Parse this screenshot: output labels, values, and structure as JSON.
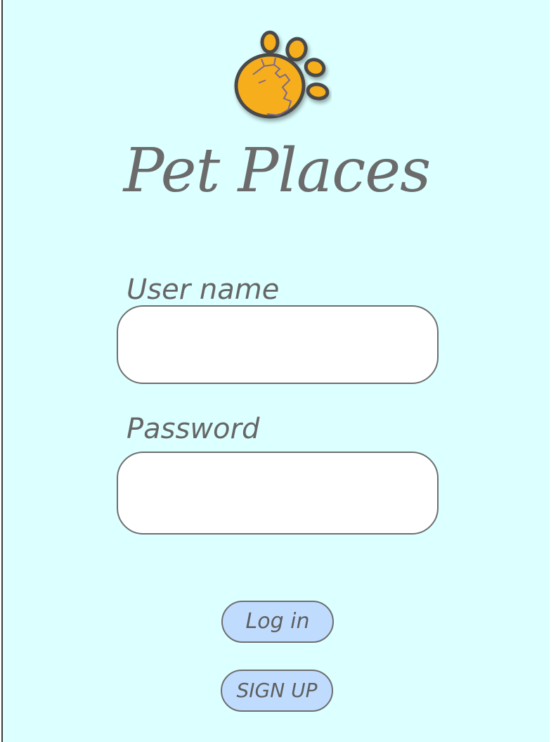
{
  "app": {
    "title": "Pet Places",
    "logo_icon": "paw-print-pet-icon"
  },
  "login_form": {
    "username_label": "User name",
    "username_value": "",
    "password_label": "Password",
    "password_value": "",
    "login_button": "Log in",
    "signup_button": "SIGN UP"
  },
  "colors": {
    "background": "#dcffff",
    "paw": "#f6ae1e",
    "outline": "#4a4a4a",
    "button_fill": "#bfdcff",
    "text": "#666666"
  }
}
